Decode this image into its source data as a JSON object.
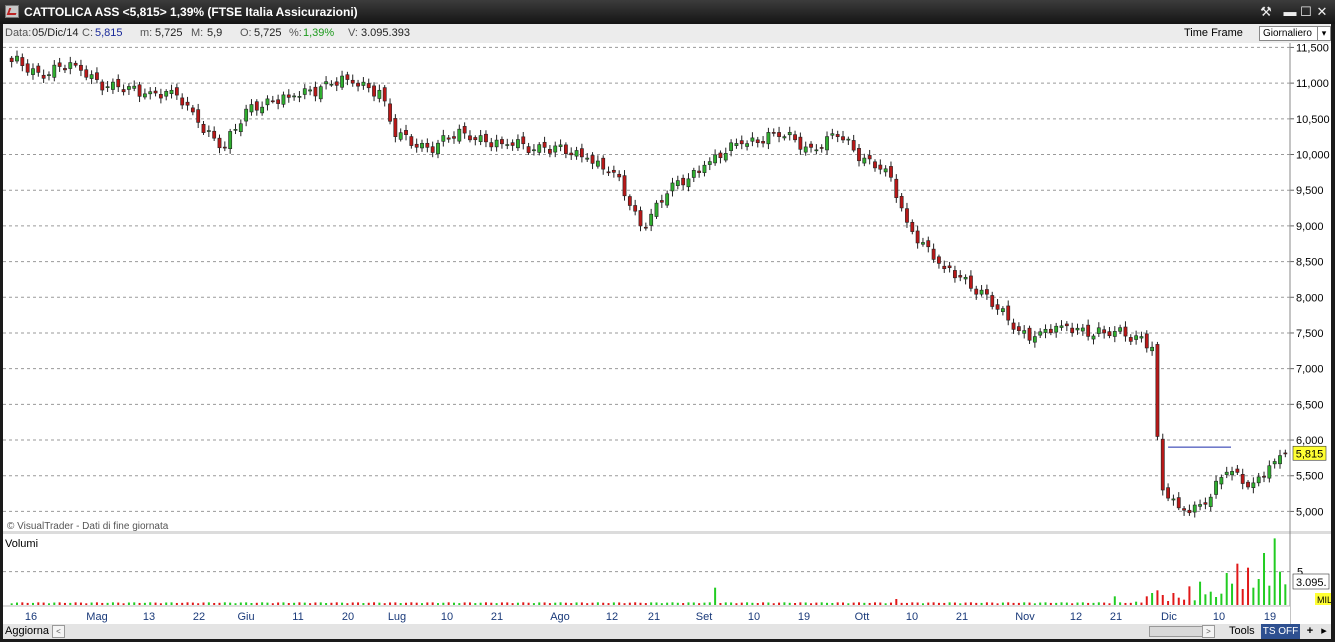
{
  "window": {
    "title": "CATTOLICA ASS <5,815> 1,39%  (FTSE Italia Assicurazioni)",
    "buttons": {
      "tools": "⚒",
      "minimize": "▬",
      "maximize": "☐",
      "close": "✕"
    }
  },
  "info": {
    "date_label": "Data:",
    "date_value": "05/Dic/14",
    "close_label": "C:",
    "close_value": "5,815",
    "min_label": "m:",
    "min_value": "5,725",
    "max_label": "M:",
    "max_value": "5,9",
    "open_label": "O:",
    "open_value": "5,725",
    "pct_label": "%:",
    "pct_value": "1,39%",
    "vol_label": "V:",
    "vol_value": "3.095.393",
    "timeframe_label": "Time Frame",
    "timeframe_value": "Giornaliero"
  },
  "colors": {
    "up": "#2fae2f",
    "down": "#b81818",
    "volume_up": "#22cc22",
    "volume_down": "#e01818",
    "price_badge": "#ffff33",
    "resistance": "#1a2aaa"
  },
  "chart_data": [
    {
      "type": "candlestick",
      "price_axis": {
        "ylim": [
          4.85,
          11.6
        ],
        "ticks": [
          "11,500",
          "11,000",
          "10,500",
          "10,000",
          "9,500",
          "9,000",
          "8,500",
          "8,000",
          "7,500",
          "7,000",
          "6,500",
          "6,000",
          "5,500",
          "5,000"
        ],
        "tick_values": [
          11.5,
          11,
          10.5,
          10,
          9.5,
          9,
          8.5,
          8,
          7.5,
          7,
          6.5,
          6,
          5.5,
          5
        ]
      },
      "last_price": "5,815",
      "resistance_level": 5.9,
      "grid": true,
      "watermark": "© VisualTrader - Dati di fine giornata",
      "x_axis_labels": [
        "16",
        "Mag",
        "13",
        "22",
        "Giu",
        "11",
        "20",
        "Lug",
        "10",
        "21",
        "Ago",
        "12",
        "21",
        "Set",
        "10",
        "19",
        "Ott",
        "10",
        "21",
        "Nov",
        "12",
        "21",
        "Dic",
        "10",
        "19"
      ],
      "keypoints": [
        {
          "i": 0,
          "c": 11.3
        },
        {
          "i": 5,
          "c": 11.15
        },
        {
          "i": 12,
          "c": 11.25
        },
        {
          "i": 18,
          "c": 10.95
        },
        {
          "i": 25,
          "c": 10.85
        },
        {
          "i": 30,
          "c": 10.9
        },
        {
          "i": 35,
          "c": 10.45
        },
        {
          "i": 40,
          "c": 10.1
        },
        {
          "i": 45,
          "c": 10.7
        },
        {
          "i": 52,
          "c": 10.8
        },
        {
          "i": 58,
          "c": 10.95
        },
        {
          "i": 63,
          "c": 11.05
        },
        {
          "i": 69,
          "c": 10.9
        },
        {
          "i": 72,
          "c": 10.25
        },
        {
          "i": 78,
          "c": 10.1
        },
        {
          "i": 85,
          "c": 10.3
        },
        {
          "i": 92,
          "c": 10.15
        },
        {
          "i": 100,
          "c": 10.1
        },
        {
          "i": 108,
          "c": 9.95
        },
        {
          "i": 113,
          "c": 9.75
        },
        {
          "i": 118,
          "c": 9.0
        },
        {
          "i": 123,
          "c": 9.45
        },
        {
          "i": 130,
          "c": 9.85
        },
        {
          "i": 137,
          "c": 10.15
        },
        {
          "i": 143,
          "c": 10.3
        },
        {
          "i": 150,
          "c": 10.1
        },
        {
          "i": 155,
          "c": 10.25
        },
        {
          "i": 160,
          "c": 9.95
        },
        {
          "i": 164,
          "c": 9.8
        },
        {
          "i": 168,
          "c": 9.05
        },
        {
          "i": 175,
          "c": 8.4
        },
        {
          "i": 182,
          "c": 8.1
        },
        {
          "i": 188,
          "c": 7.55
        },
        {
          "i": 192,
          "c": 7.45
        },
        {
          "i": 197,
          "c": 7.6
        },
        {
          "i": 205,
          "c": 7.5
        },
        {
          "i": 212,
          "c": 7.45
        },
        {
          "i": 214,
          "c": 7.3
        },
        {
          "i": 215,
          "c": 6.05
        },
        {
          "i": 216,
          "c": 5.3
        },
        {
          "i": 219,
          "c": 5.05
        },
        {
          "i": 224,
          "c": 5.1
        },
        {
          "i": 228,
          "c": 5.55
        },
        {
          "i": 233,
          "c": 5.4
        },
        {
          "i": 237,
          "c": 5.7
        },
        {
          "i": 239,
          "c": 5.815
        }
      ],
      "n_bars": 240
    },
    {
      "type": "bar",
      "title": "Volumi",
      "tick": "5",
      "last_value": "3.095.",
      "unit": "MIL",
      "ylim": [
        0,
        10.5
      ]
    }
  ],
  "status": {
    "refresh_label": "Aggiorna",
    "scroll_left": "<",
    "scroll_right": ">",
    "tools_label": "Tools",
    "ts_label": "TS OFF",
    "plus_label": "+",
    "menu_label": "▸"
  }
}
